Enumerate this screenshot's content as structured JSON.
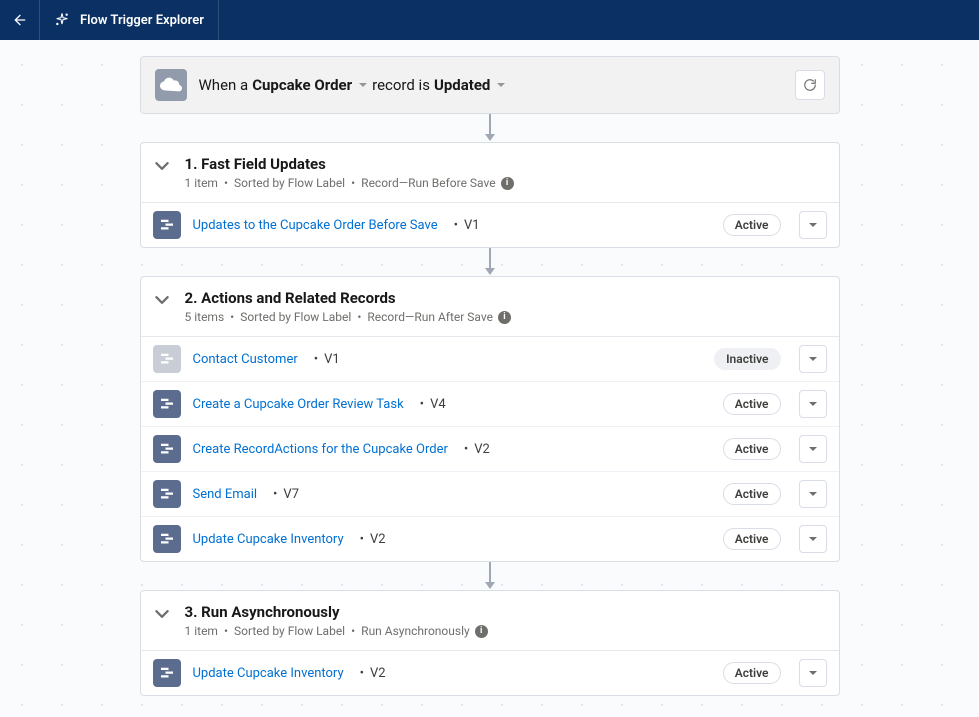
{
  "header": {
    "title": "Flow Trigger Explorer"
  },
  "trigger": {
    "prefix": "When a",
    "object": "Cupcake Order",
    "mid": "record is",
    "action": "Updated"
  },
  "sections": [
    {
      "title": "1. Fast Field Updates",
      "countText": "1 item",
      "sort": "Sorted by Flow Label",
      "context": "Record—Run Before Save",
      "flows": [
        {
          "label": "Updates to the Cupcake Order Before Save",
          "version": "V1",
          "status": "Active",
          "inactive": false
        }
      ]
    },
    {
      "title": "2. Actions and Related Records",
      "countText": "5 items",
      "sort": "Sorted by Flow Label",
      "context": "Record—Run After Save",
      "flows": [
        {
          "label": "Contact Customer",
          "version": "V1",
          "status": "Inactive",
          "inactive": true
        },
        {
          "label": "Create a Cupcake Order Review Task",
          "version": "V4",
          "status": "Active",
          "inactive": false
        },
        {
          "label": "Create RecordActions for the Cupcake Order",
          "version": "V2",
          "status": "Active",
          "inactive": false
        },
        {
          "label": "Send Email",
          "version": "V7",
          "status": "Active",
          "inactive": false
        },
        {
          "label": "Update Cupcake Inventory",
          "version": "V2",
          "status": "Active",
          "inactive": false
        }
      ]
    },
    {
      "title": "3. Run Asynchronously",
      "countText": "1 item",
      "sort": "Sorted by Flow Label",
      "context": "Run Asynchronously",
      "flows": [
        {
          "label": "Update Cupcake Inventory",
          "version": "V2",
          "status": "Active",
          "inactive": false
        }
      ]
    }
  ]
}
